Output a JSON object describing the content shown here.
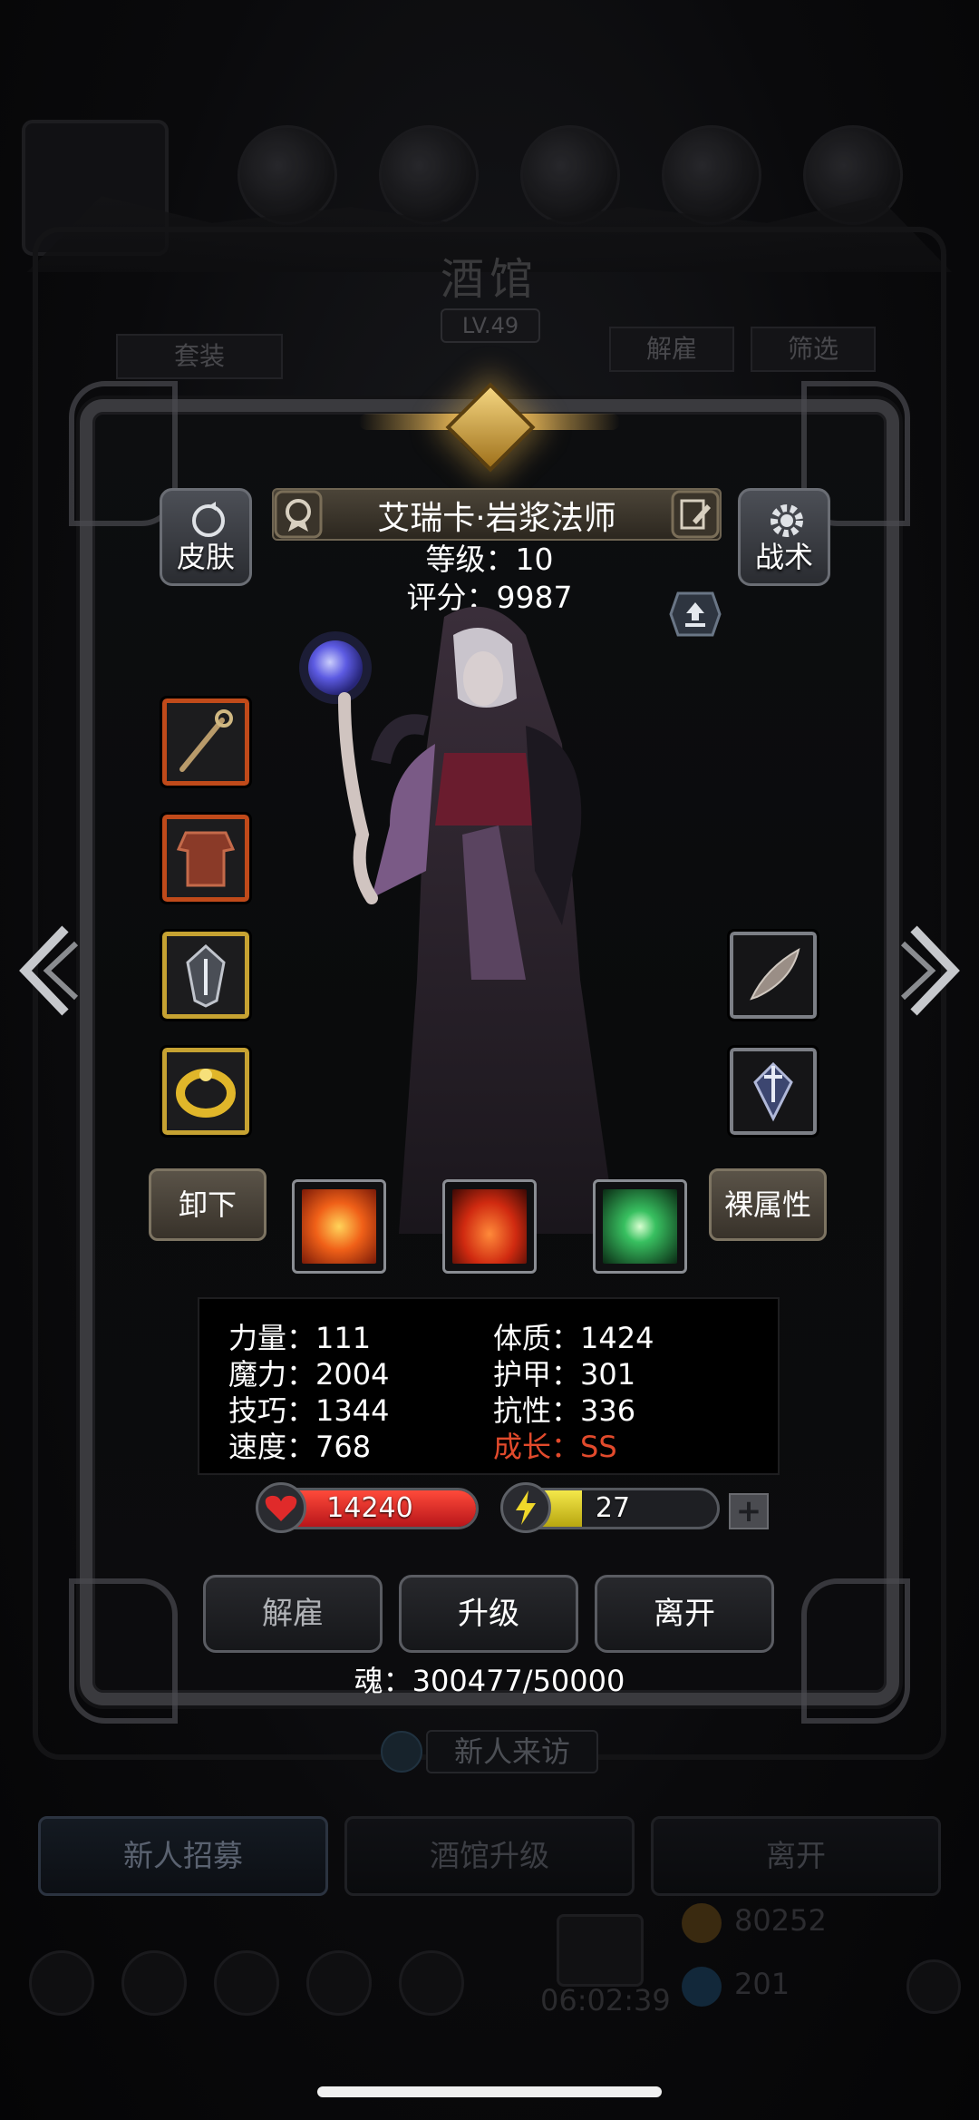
{
  "background": {
    "title": "酒馆",
    "level": "LV.49",
    "set_button": "套装",
    "dismiss_button": "解雇",
    "filter_button": "筛选",
    "new_visitor": "新人来访",
    "bottom_tabs": [
      "新人招募",
      "酒馆升级",
      "离开"
    ],
    "timer": "06:02:39",
    "gold": "80252",
    "gems": "201"
  },
  "hero": {
    "name": "艾瑞卡·岩浆法师",
    "level_text": "等级：10",
    "score_text": "评分：9987",
    "skin_label": "皮肤",
    "tactic_label": "战术",
    "unequip_label": "卸下",
    "naked_attr_label": "裸属性"
  },
  "equipment_left": [
    {
      "name": "staff",
      "rarity": "orange",
      "icon": "staff-icon"
    },
    {
      "name": "armor",
      "rarity": "orange",
      "icon": "armor-icon"
    },
    {
      "name": "amulet",
      "rarity": "gold",
      "icon": "amulet-icon"
    },
    {
      "name": "ring",
      "rarity": "gold",
      "icon": "ring-icon"
    }
  ],
  "equipment_right": [
    {
      "name": "feather",
      "rarity": "plain",
      "icon": "feather-icon"
    },
    {
      "name": "emblem",
      "rarity": "plain",
      "icon": "sword-emblem-icon"
    }
  ],
  "skills": [
    {
      "icon": "fire-burst-icon"
    },
    {
      "icon": "flame-icon"
    },
    {
      "icon": "green-crystal-icon"
    }
  ],
  "stats": {
    "strength": "力量：111",
    "magic": "魔力：2004",
    "skill": "技巧：1344",
    "speed": "速度：768",
    "constitution": "体质：1424",
    "armor": "护甲：301",
    "resistance": "抗性：336",
    "growth": "成长：SS"
  },
  "hp": {
    "value": "14240",
    "fill_fraction": 1.0
  },
  "energy": {
    "value": "27",
    "fill_fraction": 0.35
  },
  "plus_label": "+",
  "actions": {
    "dismiss": "解雇",
    "upgrade": "升级",
    "leave": "离开"
  },
  "soul_text": "魂：300477/50000",
  "colors": {
    "hp": "#d42a2a",
    "energy": "#e0d020",
    "growth": "#e24a2c",
    "emblem_gold": "#e9b85a"
  }
}
